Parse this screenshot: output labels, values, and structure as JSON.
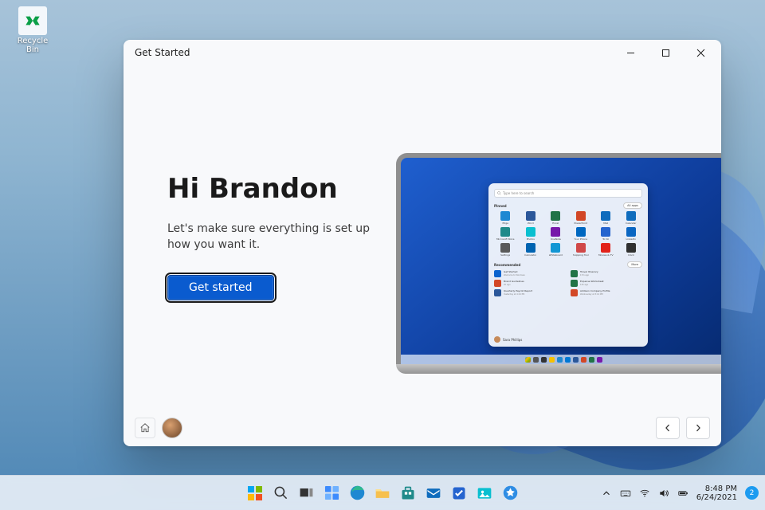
{
  "desktop": {
    "recycle_bin_label": "Recycle Bin"
  },
  "window": {
    "title": "Get Started",
    "heading": "Hi Brandon",
    "subtext": "Let's make sure everything is set up how you want it.",
    "primary_button": "Get started"
  },
  "startmenu": {
    "search_placeholder": "Type here to search",
    "pinned_label": "Pinned",
    "all_apps_label": "All apps",
    "pinned": [
      {
        "label": "Edge",
        "color": "#1e88d2"
      },
      {
        "label": "Word",
        "color": "#2b579a"
      },
      {
        "label": "Excel",
        "color": "#217346"
      },
      {
        "label": "PowerPoint",
        "color": "#d24726"
      },
      {
        "label": "Mail",
        "color": "#0f6cbd"
      },
      {
        "label": "Calendar",
        "color": "#0f6cbd"
      },
      {
        "label": "Microsoft Store",
        "color": "#1f8a8a"
      },
      {
        "label": "Photos",
        "color": "#0abfd0"
      },
      {
        "label": "OneNote",
        "color": "#7719aa"
      },
      {
        "label": "Your Phone",
        "color": "#0067c0"
      },
      {
        "label": "To Do",
        "color": "#2564cf"
      },
      {
        "label": "LinkedIn",
        "color": "#0a66c2"
      },
      {
        "label": "Settings",
        "color": "#5a5a5a"
      },
      {
        "label": "Calculator",
        "color": "#0063b1"
      },
      {
        "label": "Whiteboard",
        "color": "#1296d4"
      },
      {
        "label": "Snipping Tool",
        "color": "#d04848"
      },
      {
        "label": "Movies & TV",
        "color": "#e2231a"
      },
      {
        "label": "Clock",
        "color": "#303030"
      }
    ],
    "recommended_label": "Recommended",
    "more_label": "More",
    "recommended": [
      {
        "title": "Get Started",
        "sub": "Welcome to Windows",
        "color": "#0b63ce"
      },
      {
        "title": "Travel Itinerary",
        "sub": "17m ago",
        "color": "#217346"
      },
      {
        "title": "Brand Guidelines",
        "sub": "2h ago",
        "color": "#d24726"
      },
      {
        "title": "Expense Worksheet",
        "sub": "12h ago",
        "color": "#217346"
      },
      {
        "title": "Quarterly Payroll Report",
        "sub": "Yesterday at 4:24 PM",
        "color": "#2b579a"
      },
      {
        "title": "Addison Company Profile",
        "sub": "Wednesday at 3:14 PM",
        "color": "#d24726"
      }
    ],
    "user_name": "Sara Phillips"
  },
  "taskbar": {
    "time": "8:48 PM",
    "date": "6/24/2021",
    "notification_count": "2"
  }
}
